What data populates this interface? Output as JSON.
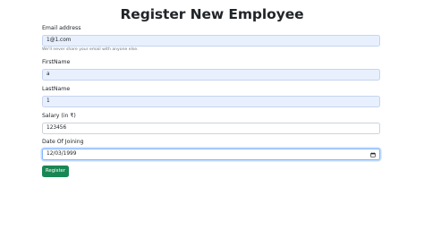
{
  "page": {
    "title": "Register New Employee"
  },
  "form": {
    "email": {
      "label": "Email address",
      "value": "1@1.com",
      "help": "We'll never share your email with anyone else."
    },
    "first_name": {
      "label": "FirstName",
      "value": "a"
    },
    "last_name": {
      "label": "LastName",
      "value": "1"
    },
    "salary": {
      "label": "Salary (in ₹)",
      "value": "123456"
    },
    "date_of_joining": {
      "label": "Date Of Joining",
      "value": "12/03/1999",
      "icon": "calendar-icon"
    },
    "submit_label": "Register"
  },
  "colors": {
    "autofill_bg": "#e8f0fe",
    "button_bg": "#198754",
    "focus_border": "#86b7fe"
  }
}
